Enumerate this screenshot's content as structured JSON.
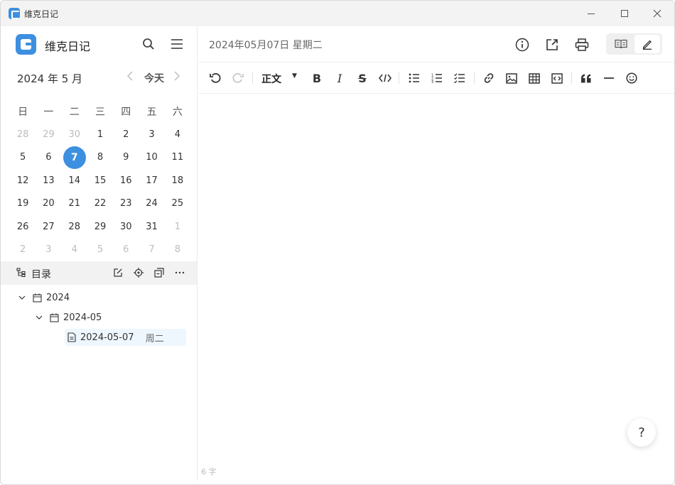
{
  "window": {
    "title": "维克日记"
  },
  "sidebar": {
    "app_name": "维克日记",
    "calendar": {
      "month_label": "2024 年 5 月",
      "today_label": "今天",
      "weekdays": [
        "日",
        "一",
        "二",
        "三",
        "四",
        "五",
        "六"
      ],
      "weeks": [
        [
          {
            "d": "28",
            "m": true
          },
          {
            "d": "29",
            "m": true
          },
          {
            "d": "30",
            "m": true
          },
          {
            "d": "1"
          },
          {
            "d": "2"
          },
          {
            "d": "3"
          },
          {
            "d": "4"
          }
        ],
        [
          {
            "d": "5"
          },
          {
            "d": "6"
          },
          {
            "d": "7",
            "sel": true
          },
          {
            "d": "8"
          },
          {
            "d": "9"
          },
          {
            "d": "10"
          },
          {
            "d": "11"
          }
        ],
        [
          {
            "d": "12"
          },
          {
            "d": "13"
          },
          {
            "d": "14"
          },
          {
            "d": "15"
          },
          {
            "d": "16"
          },
          {
            "d": "17"
          },
          {
            "d": "18"
          }
        ],
        [
          {
            "d": "19"
          },
          {
            "d": "20"
          },
          {
            "d": "21"
          },
          {
            "d": "22"
          },
          {
            "d": "23"
          },
          {
            "d": "24"
          },
          {
            "d": "25"
          }
        ],
        [
          {
            "d": "26"
          },
          {
            "d": "27"
          },
          {
            "d": "28"
          },
          {
            "d": "29"
          },
          {
            "d": "30"
          },
          {
            "d": "31"
          },
          {
            "d": "1",
            "m": true
          }
        ],
        [
          {
            "d": "2",
            "m": true
          },
          {
            "d": "3",
            "m": true
          },
          {
            "d": "4",
            "m": true
          },
          {
            "d": "5",
            "m": true
          },
          {
            "d": "6",
            "m": true
          },
          {
            "d": "7",
            "m": true
          },
          {
            "d": "8",
            "m": true
          }
        ]
      ],
      "selected_color": "#3d8fe0"
    },
    "directory": {
      "label": "目录",
      "tree": {
        "year": "2024",
        "month": "2024-05",
        "file": "2024-05-07",
        "file_weekday": "周二"
      }
    }
  },
  "main": {
    "date_title": "2024年05月07日 星期二",
    "toolbar": {
      "paragraph_style": "正文"
    },
    "word_count": "6 字",
    "help_label": "?"
  }
}
